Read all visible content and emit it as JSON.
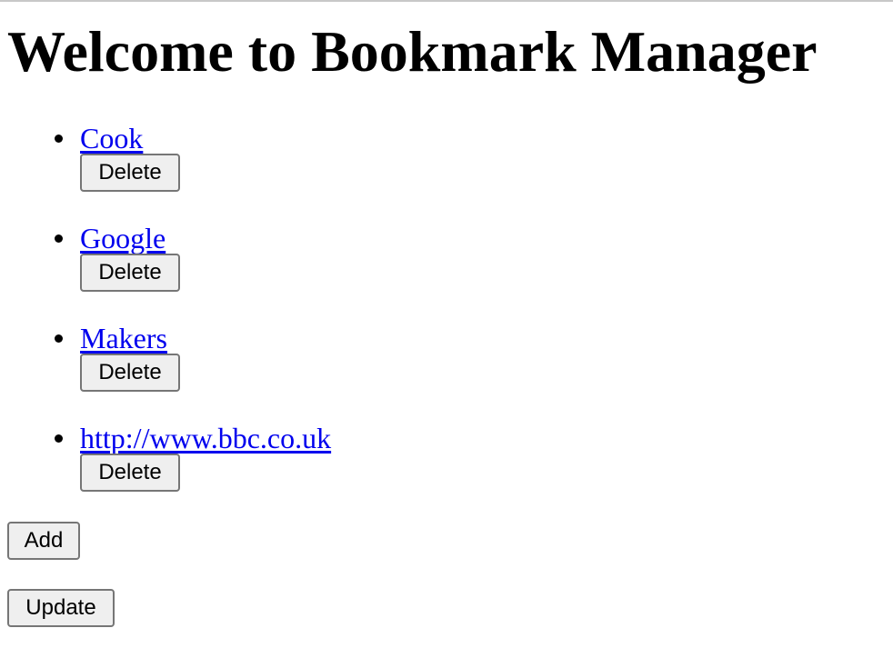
{
  "header": {
    "title": "Welcome to Bookmark Manager"
  },
  "bookmarks": [
    {
      "title": "Cook",
      "delete_label": "Delete"
    },
    {
      "title": "Google",
      "delete_label": "Delete"
    },
    {
      "title": "Makers",
      "delete_label": "Delete"
    },
    {
      "title": "http://www.bbc.co.uk",
      "delete_label": "Delete"
    }
  ],
  "actions": {
    "add_label": "Add",
    "update_label": "Update"
  },
  "colors": {
    "link": "#0000ee",
    "button_bg": "#efefef",
    "button_border": "#767676"
  }
}
